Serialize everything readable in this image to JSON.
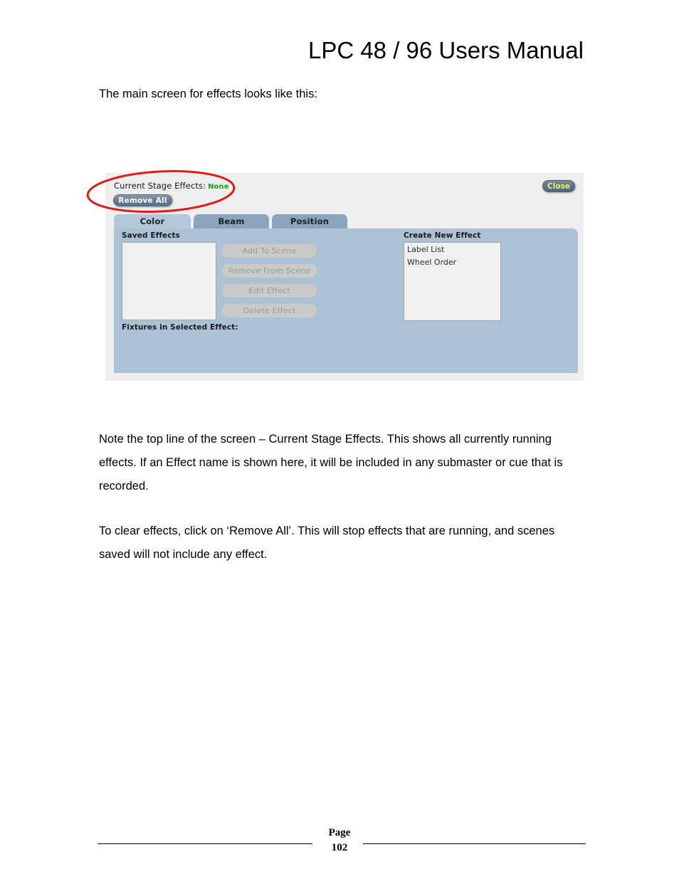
{
  "document": {
    "title": "LPC 48 / 96 Users Manual",
    "intro_line": "The main screen for effects looks like this:",
    "paragraph_1": "Note the top line of the screen – Current Stage Effects.  This shows all currently running effects.  If an Effect name is shown here, it will be included in any submaster or cue that is recorded.",
    "paragraph_2": "To clear effects, click on ‘Remove All’.  This will stop effects that are running, and scenes saved will not include any effect.",
    "footer": {
      "page_word": "Page",
      "page_number": "102"
    }
  },
  "screenshot": {
    "status": {
      "label": "Current Stage Effects:",
      "value": "None",
      "value_color": "#14a014"
    },
    "remove_all_button": "Remove All",
    "close_button": "Close",
    "tabs": [
      {
        "label": "Color",
        "active": true
      },
      {
        "label": "Beam",
        "active": false
      },
      {
        "label": "Position",
        "active": false
      }
    ],
    "saved_effects": {
      "label": "Saved Effects",
      "items": []
    },
    "action_buttons": [
      "Add To Scene",
      "Remove From Scene",
      "Edit Effect",
      "Delete Effect"
    ],
    "fixtures_label": "Fixtures in Selected Effect:",
    "create_new_effect": {
      "label": "Create New Effect",
      "items": [
        "Label List",
        "Wheel Order"
      ]
    },
    "colors": {
      "window_background": "#eeeeee",
      "panel_blue": "#adc1d5",
      "tab_active": "#b3c6da",
      "tab_inactive": "#8aa6bf",
      "button_slate": "#5c7089",
      "close_text": "#f6f06a",
      "disabled_button": "#cacaca",
      "annotation": "#e01b1b"
    }
  },
  "annotation": {
    "shape": "ellipse",
    "target": "Current Stage Effects and Remove All"
  }
}
